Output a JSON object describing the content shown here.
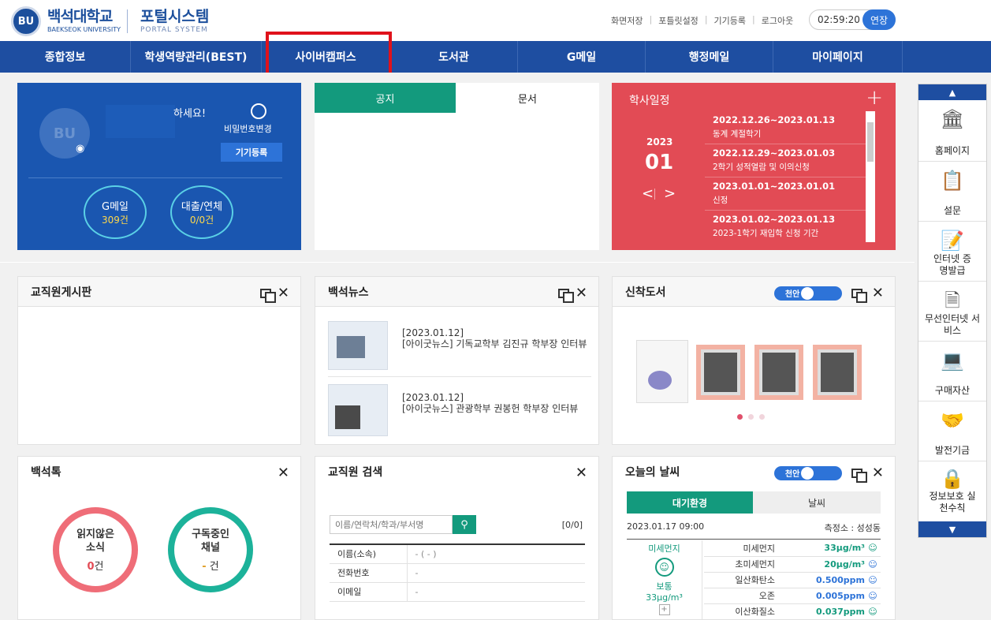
{
  "header": {
    "logo_ko": "백석대학교",
    "logo_en": "BAEKSEOK UNIVERSITY",
    "emblem": "BU",
    "portal_ko": "포털시스템",
    "portal_en": "PORTAL SYSTEM",
    "links": [
      "화면저장",
      "포틀릿설정",
      "기기등록",
      "로그아웃"
    ],
    "timer": "02:59:20",
    "extend_label": "연장"
  },
  "nav": {
    "items": [
      "종합정보",
      "학생역량관리(BEST)",
      "사이버캠퍼스",
      "도서관",
      "G메일",
      "행정메일",
      "마이페이지"
    ]
  },
  "profile": {
    "greeting": "하세요!",
    "pw_label": "비밀번호변경",
    "device_btn": "기기등록",
    "gmail_label": "G메일",
    "gmail_count": "309건",
    "loan_label": "대출/연체",
    "loan_count": "0/0건"
  },
  "notice": {
    "tab1": "공지",
    "tab2": "문서"
  },
  "calendar": {
    "title": "학사일정",
    "year": "2023",
    "month": "01",
    "events": [
      {
        "date": "2022.12.26~2023.01.13",
        "desc": "동계 계절학기"
      },
      {
        "date": "2022.12.29~2023.01.03",
        "desc": "2학기 성적열람 및 이의신청"
      },
      {
        "date": "2023.01.01~2023.01.01",
        "desc": "신정"
      },
      {
        "date": "2023.01.02~2023.01.13",
        "desc": "2023-1학기 재입학 신청 기간"
      }
    ]
  },
  "staff_board": {
    "title": "교직원게시판"
  },
  "news": {
    "title": "백석뉴스",
    "items": [
      {
        "date": "[2023.01.12]",
        "text": "[아이굿뉴스] 기독교학부 김진규 학부장 인터뷰"
      },
      {
        "date": "[2023.01.12]",
        "text": "[아이굿뉴스] 관광학부 권봉헌 학부장 인터뷰"
      }
    ]
  },
  "books": {
    "title": "신착도서",
    "toggle": "천안"
  },
  "talk": {
    "title": "백석톡",
    "unread_label": "읽지않은 소식",
    "unread_count": "0",
    "unread_unit": "건",
    "sub_label": "구독중인 채널",
    "sub_count": "-",
    "sub_unit": "건"
  },
  "staff_search": {
    "title": "교직원 검색",
    "placeholder": "이름/연락처/학과/부서명",
    "count": "[0/0]",
    "rows": [
      {
        "label": "이름(소속)",
        "value": "- ( - )"
      },
      {
        "label": "전화번호",
        "value": "-"
      },
      {
        "label": "이메일",
        "value": "-"
      }
    ]
  },
  "weather": {
    "title": "오늘의 날씨",
    "toggle": "천안",
    "tab1": "대기환경",
    "tab2": "날씨",
    "datetime": "2023.01.17 09:00",
    "station": "측정소 : 성성동",
    "main_label": "미세먼지",
    "main_status": "보통",
    "main_value": "33μg/m³",
    "rows": [
      {
        "label": "미세먼지",
        "value": "33μg/m³"
      },
      {
        "label": "초미세먼지",
        "value": "20μg/m³"
      },
      {
        "label": "일산화탄소",
        "value": "0.500ppm"
      },
      {
        "label": "오존",
        "value": "0.005ppm"
      },
      {
        "label": "이산화질소",
        "value": "0.037ppm"
      }
    ]
  },
  "sidebar": {
    "items": [
      "홈페이지",
      "설문",
      "인터넷 증명발급",
      "무선인터넷 서비스",
      "구매자산",
      "발전기금",
      "정보보호 실천수칙"
    ]
  },
  "colors": {
    "nav": "#1e4ea1",
    "profile": "#1a56b0",
    "calendar": "#e24b55",
    "tab_active": "#139a7d",
    "highlight": "#e0121b"
  }
}
